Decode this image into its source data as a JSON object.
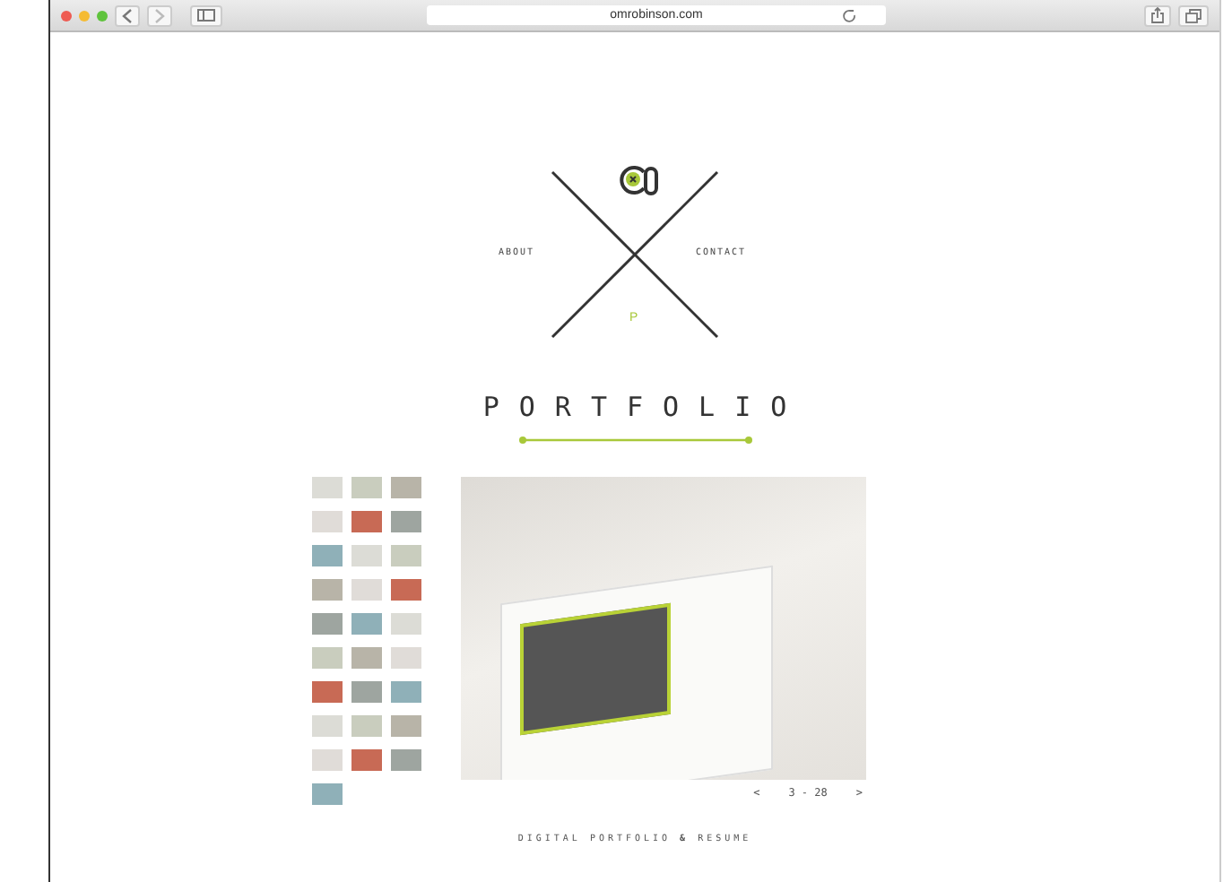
{
  "browser": {
    "url": "omrobinson.com"
  },
  "nav": {
    "left": "ABOUT",
    "right": "CONTACT",
    "bottom": "P"
  },
  "heading": "PORTFOLIO",
  "thumbnails": [
    {
      "kind": "photo"
    },
    {
      "kind": "photo"
    },
    {
      "kind": "photo"
    },
    {
      "kind": "photo"
    },
    {
      "kind": "photo"
    },
    {
      "kind": "photo"
    },
    {
      "kind": "photo"
    },
    {
      "kind": "photo"
    },
    {
      "kind": "photo"
    },
    {
      "kind": "photo"
    },
    {
      "kind": "photo"
    },
    {
      "kind": "photo"
    },
    {
      "kind": "photo"
    },
    {
      "kind": "photo"
    },
    {
      "kind": "photo"
    },
    {
      "kind": "photo"
    },
    {
      "kind": "photo"
    },
    {
      "kind": "photo"
    },
    {
      "kind": "photo"
    },
    {
      "kind": "photo"
    },
    {
      "kind": "photo"
    },
    {
      "kind": "photo"
    },
    {
      "kind": "photo"
    },
    {
      "kind": "photo"
    },
    {
      "kind": "photo"
    },
    {
      "kind": "photo"
    },
    {
      "kind": "photo"
    },
    {
      "kind": "photo"
    }
  ],
  "gallery": {
    "prev": "<",
    "counter": "3 - 28",
    "next": ">"
  },
  "footer": "DIGITAL PORTFOLIO **&** RESUME"
}
